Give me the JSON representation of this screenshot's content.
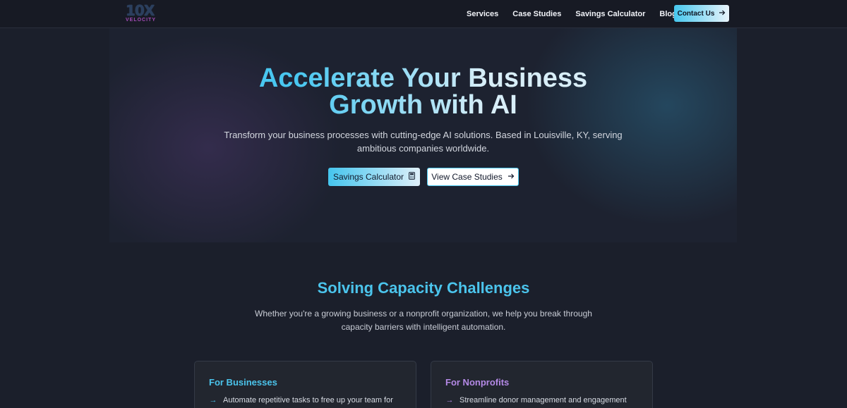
{
  "header": {
    "logo": {
      "mark": "10X",
      "word": "VELOCITY"
    },
    "nav": [
      {
        "label": "Services"
      },
      {
        "label": "Case Studies"
      },
      {
        "label": "Savings Calculator"
      },
      {
        "label": "Blog"
      }
    ],
    "contact_label": "Contact Us",
    "contact_icon": "arrow-right-icon"
  },
  "hero": {
    "title_line1": "Accelerate Your Business",
    "title_line2": "Growth with AI",
    "subtitle_line1": "Transform your business processes with cutting-edge AI solutions. Based in Louisville, KY, serving",
    "subtitle_line2": "ambitious companies worldwide.",
    "primary_button": "Savings Calculator",
    "primary_icon": "calculator-icon",
    "secondary_button": "View Case Studies",
    "secondary_icon": "arrow-right-icon"
  },
  "capacity": {
    "title": "Solving Capacity Challenges",
    "subtitle_line1": "Whether you're a growing business or a nonprofit organization, we help you break through",
    "subtitle_line2": "capacity barriers with intelligent automation.",
    "cards": [
      {
        "title": "For Businesses",
        "item": "Automate repetitive tasks to free up your team for"
      },
      {
        "title": "For Nonprofits",
        "item": "Streamline donor management and engagement"
      }
    ]
  },
  "colors": {
    "accent_cyan": "#4bc4ec",
    "accent_purple": "#b489e6",
    "background": "#1b1f2b"
  }
}
